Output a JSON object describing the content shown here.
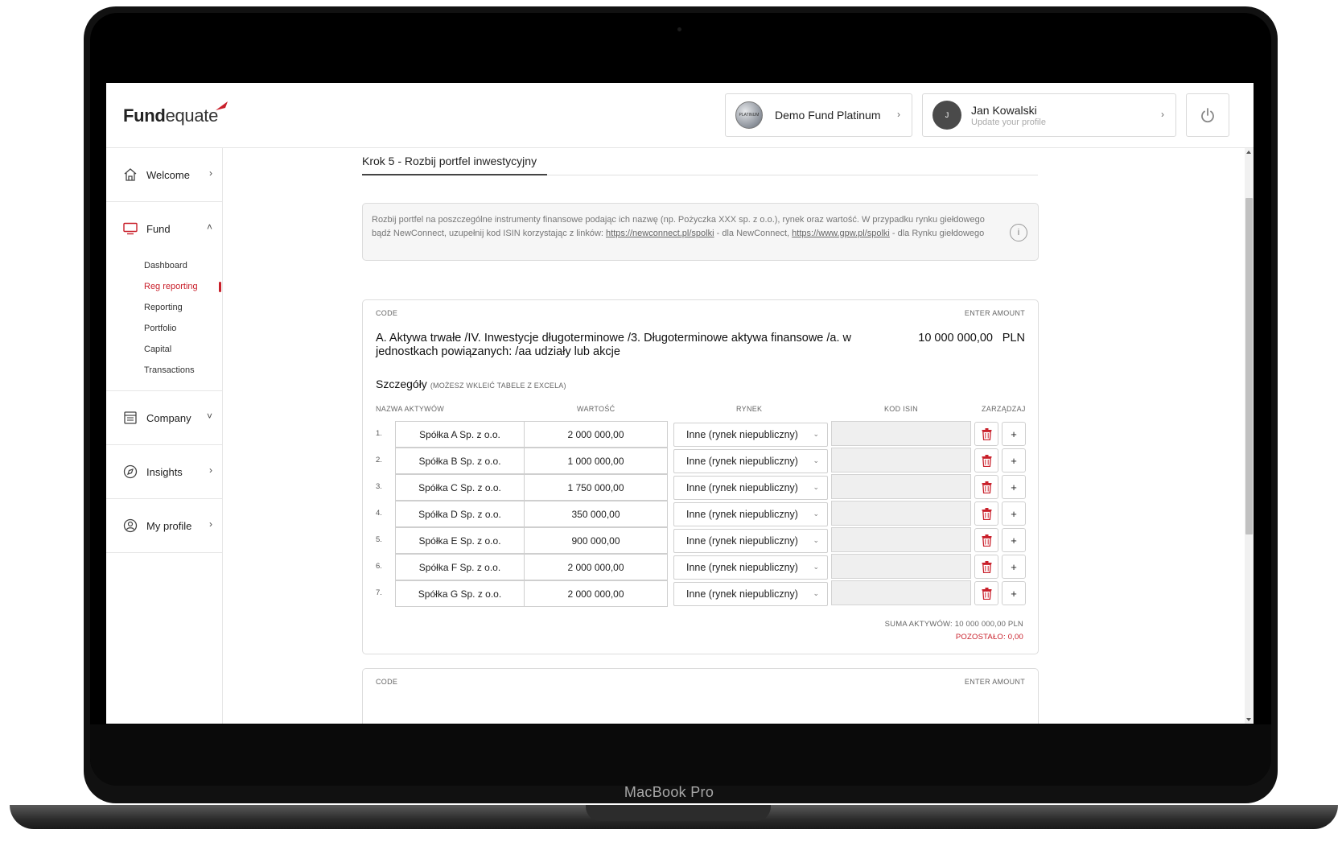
{
  "device": {
    "brand": "MacBook Pro"
  },
  "header": {
    "logo_bold": "Fund",
    "logo_light": "equate",
    "fund_selector": {
      "name": "Demo Fund Platinum",
      "avatar_text": "PLATINUM"
    },
    "user": {
      "initial": "J",
      "name": "Jan Kowalski",
      "subtitle": "Update your profile"
    }
  },
  "sidebar": {
    "items": [
      {
        "label": "Welcome",
        "icon": "home-icon",
        "chevron": "›"
      },
      {
        "label": "Fund",
        "icon": "monitor-icon",
        "chevron": "˄"
      },
      {
        "label": "Company",
        "icon": "company-icon",
        "chevron": "˅"
      },
      {
        "label": "Insights",
        "icon": "compass-icon",
        "chevron": "›"
      },
      {
        "label": "My profile",
        "icon": "user-icon",
        "chevron": "›"
      }
    ],
    "fund_subitems": [
      "Dashboard",
      "Reg reporting",
      "Reporting",
      "Portfolio",
      "Capital",
      "Transactions"
    ],
    "active_subitem": "Reg reporting"
  },
  "main": {
    "step_title": "Krok 5 - Rozbij portfel inwestycyjny",
    "info": {
      "text_1": "Rozbij portfel na poszczególne instrumenty finansowe podając ich nazwę (np. Pożyczka XXX sp. z o.o.), rynek oraz wartość. W przypadku rynku giełdowego bądź NewConnect, uzupełnij kod ISIN korzystając z linków: ",
      "link_1": "https://newconnect.pl/spolki",
      "text_2": " - dla NewConnect, ",
      "link_2": "https://www.gpw.pl/spolki",
      "text_3": " - dla Rynku giełdowego",
      "icon": "i"
    },
    "card": {
      "code_label": "CODE",
      "amount_label": "ENTER AMOUNT",
      "description": "A. Aktywa trwałe /IV. Inwestycje długoterminowe /3. Długoterminowe aktywa finansowe /a. w jednostkach powiązanych: /aa udziały lub akcje",
      "amount": "10 000 000,00",
      "currency": "PLN",
      "details_title": "Szczegóły",
      "details_hint": "(MOŻESZ WKLEIĆ TABELE Z EXCELA)",
      "columns": {
        "name": "NAZWA AKTYWÓW",
        "value": "WARTOŚĆ",
        "market": "RYNEK",
        "isin": "KOD ISIN",
        "manage": "ZARZĄDZAJ"
      },
      "rows": [
        {
          "num": "1.",
          "name": "Spółka A Sp. z o.o.",
          "value": "2 000 000,00",
          "market": "Inne (rynek niepubliczny)",
          "isin": ""
        },
        {
          "num": "2.",
          "name": "Spółka B Sp. z o.o.",
          "value": "1 000 000,00",
          "market": "Inne (rynek niepubliczny)",
          "isin": ""
        },
        {
          "num": "3.",
          "name": "Spółka C Sp. z o.o.",
          "value": "1 750 000,00",
          "market": "Inne (rynek niepubliczny)",
          "isin": ""
        },
        {
          "num": "4.",
          "name": "Spółka D Sp. z o.o.",
          "value": "350 000,00",
          "market": "Inne (rynek niepubliczny)",
          "isin": ""
        },
        {
          "num": "5.",
          "name": "Spółka E Sp. z o.o.",
          "value": "900 000,00",
          "market": "Inne (rynek niepubliczny)",
          "isin": ""
        },
        {
          "num": "6.",
          "name": "Spółka F Sp. z o.o.",
          "value": "2 000 000,00",
          "market": "Inne (rynek niepubliczny)",
          "isin": ""
        },
        {
          "num": "7.",
          "name": "Spółka G Sp. z o.o.",
          "value": "2 000 000,00",
          "market": "Inne (rynek niepubliczny)",
          "isin": ""
        }
      ],
      "sum_text": "SUMA AKTYWÓW: 10 000 000,00 PLN",
      "remaining_text": "POZOSTAŁO: 0,00",
      "plus_symbol": "+"
    },
    "next_card": {
      "code_label": "CODE",
      "amount_label": "ENTER AMOUNT"
    }
  },
  "colors": {
    "accent": "#c9202b",
    "border": "#dcdcdc",
    "text": "#222222"
  }
}
